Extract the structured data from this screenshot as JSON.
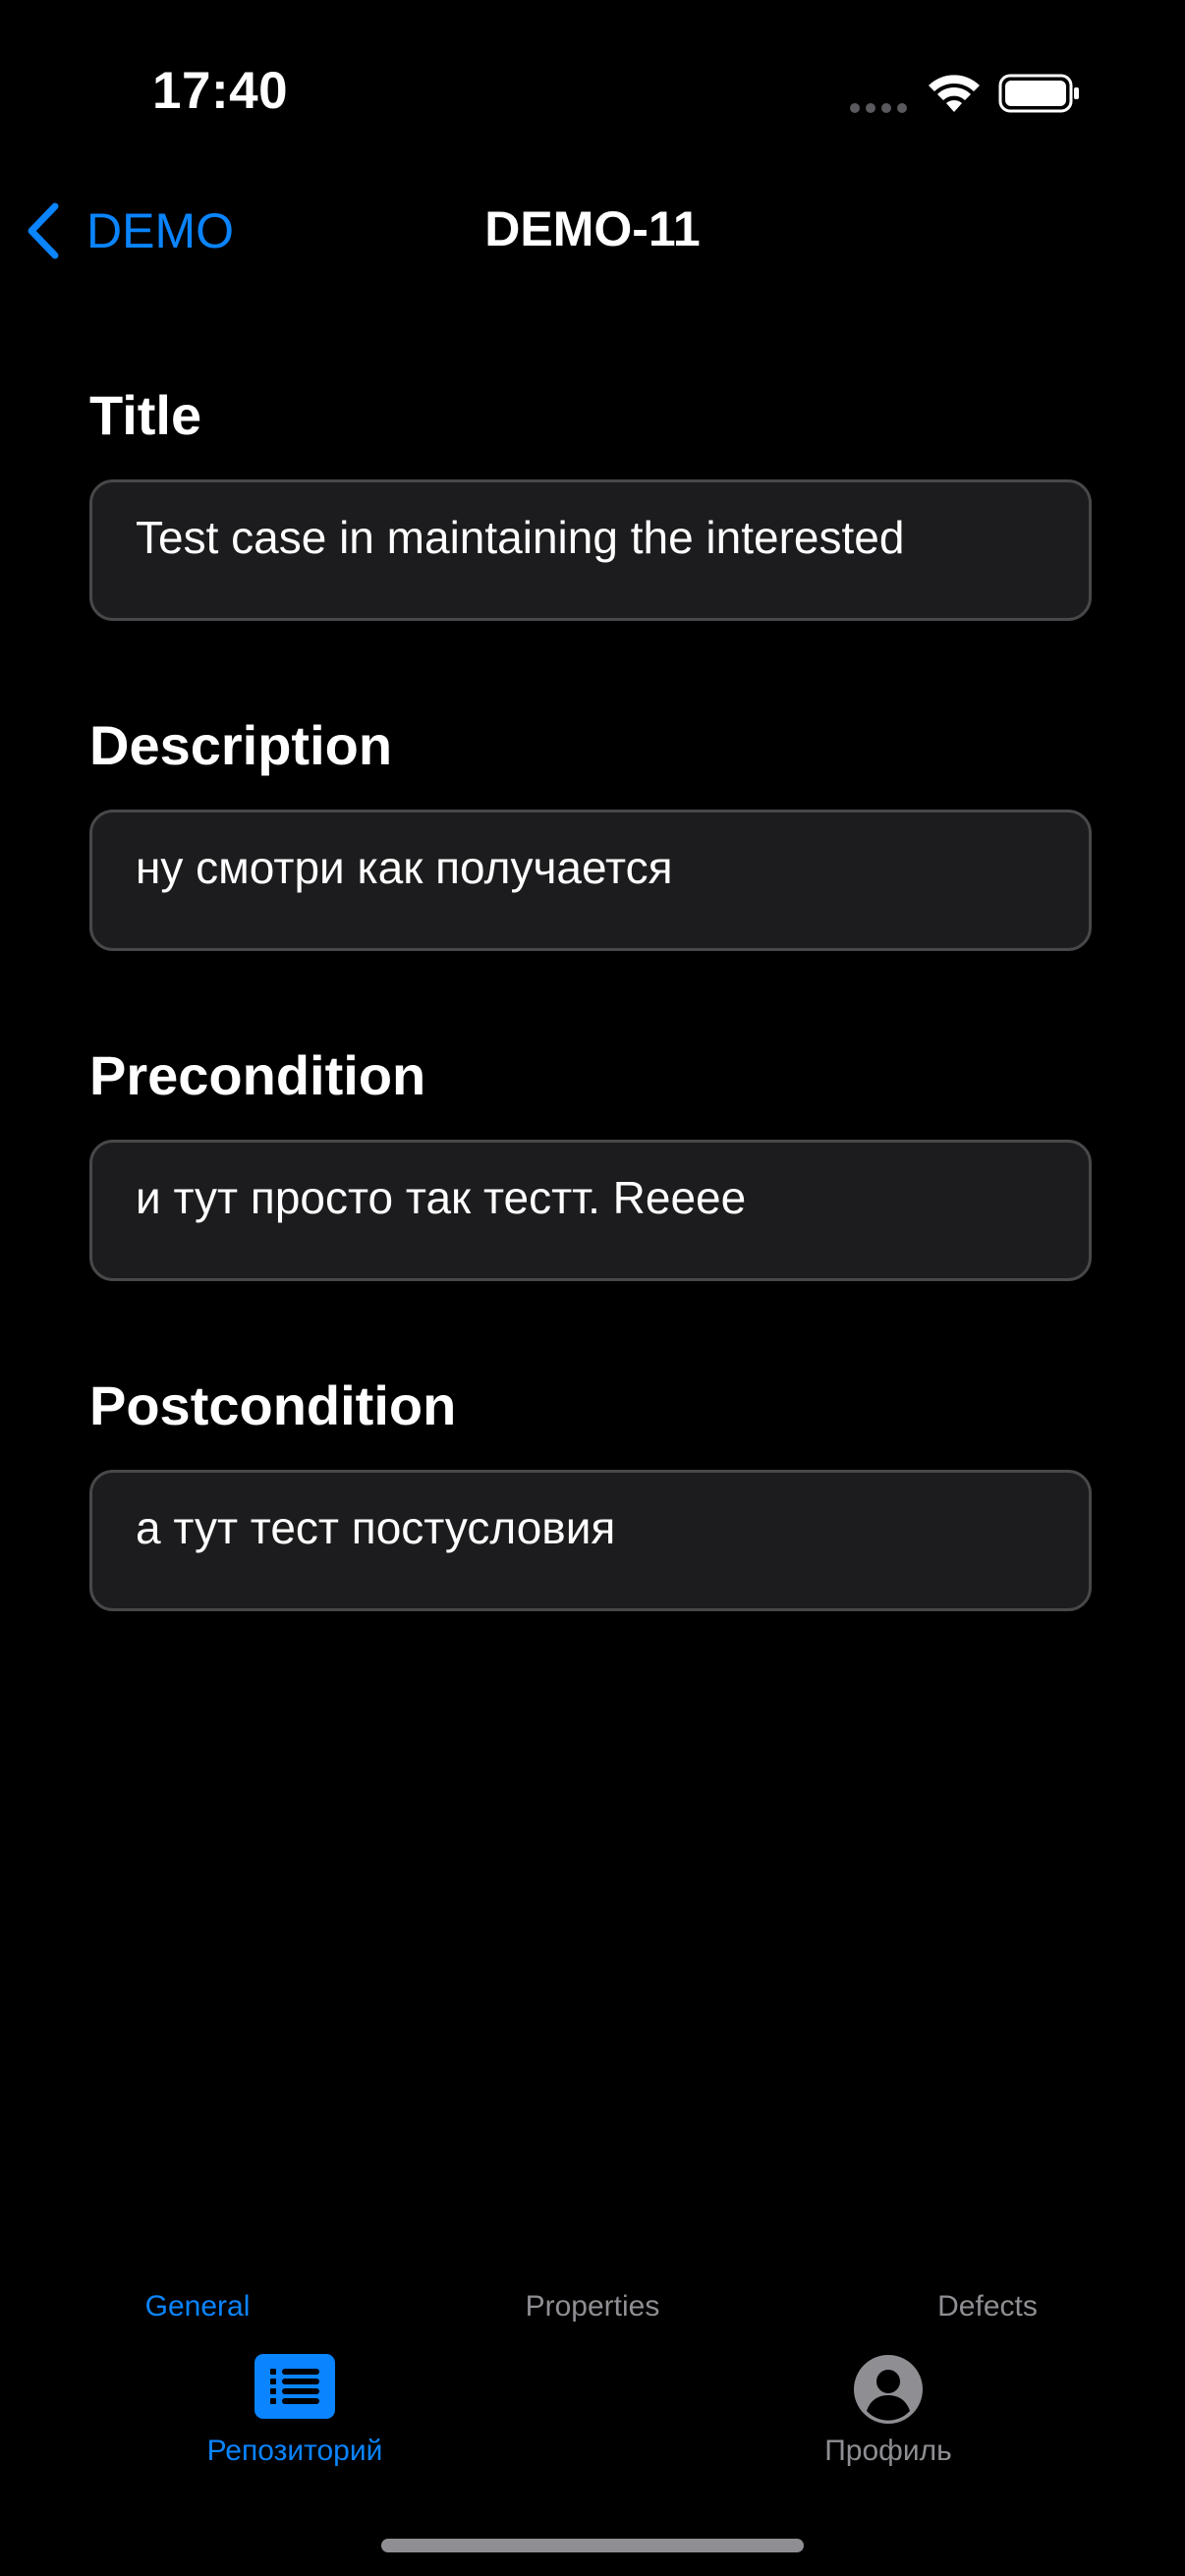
{
  "status_bar": {
    "time": "17:40"
  },
  "nav": {
    "back_label": "DEMO",
    "title": "DEMO-11"
  },
  "fields": [
    {
      "label": "Title",
      "value": "Test case in maintaining the interested"
    },
    {
      "label": "Description",
      "value": "ну смотри как получается"
    },
    {
      "label": "Precondition",
      "value": "и тут просто так тестт. Reeee"
    },
    {
      "label": "Postcondition",
      "value": "а тут тест постусловия"
    }
  ],
  "section_tabs": [
    {
      "label": "General",
      "active": true
    },
    {
      "label": "Properties",
      "active": false
    },
    {
      "label": "Defects",
      "active": false
    }
  ],
  "tab_bar": [
    {
      "label": "Репозиторий",
      "icon": "list-icon",
      "active": true
    },
    {
      "label": "Профиль",
      "icon": "person-icon",
      "active": false
    }
  ],
  "colors": {
    "accent": "#0a84ff",
    "background": "#000000",
    "field_background": "#1c1c1e",
    "field_border": "#48484a",
    "inactive": "#8e8e93"
  }
}
